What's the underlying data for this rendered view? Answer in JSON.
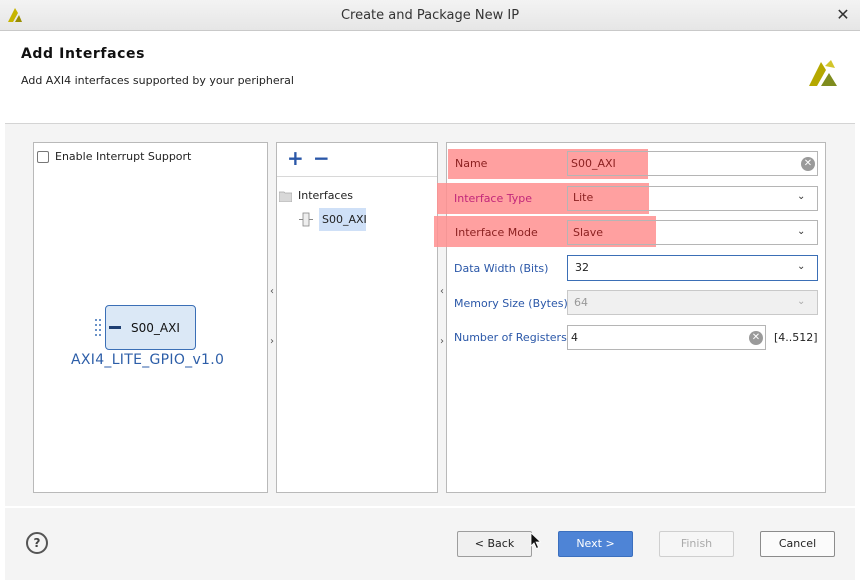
{
  "window": {
    "title": "Create and Package New IP",
    "close_glyph": "✕"
  },
  "header": {
    "title": "Add Interfaces",
    "subtitle": "Add AXI4 interfaces supported by your peripheral"
  },
  "left_panel": {
    "interrupt_label": "Enable Interrupt Support",
    "interrupt_checked": false,
    "ip_port": "S00_AXI",
    "ip_name": "AXI4_LITE_GPIO_v1.0"
  },
  "interfaces_panel": {
    "add_glyph": "+",
    "remove_glyph": "−",
    "root_label": "Interfaces",
    "items": [
      "S00_AXI"
    ]
  },
  "form": {
    "name": {
      "label": "Name",
      "value": "S00_AXI"
    },
    "interface_type": {
      "label": "Interface Type",
      "value": "Lite"
    },
    "interface_mode": {
      "label": "Interface Mode",
      "value": "Slave"
    },
    "data_width": {
      "label": "Data Width (Bits)",
      "value": "32"
    },
    "memory_size": {
      "label": "Memory Size (Bytes)",
      "value": "64"
    },
    "num_registers": {
      "label": "Number of Registers",
      "value": "4",
      "range": "[4..512]"
    }
  },
  "footer": {
    "help": "?",
    "back": "< Back",
    "next": "Next >",
    "finish": "Finish",
    "cancel": "Cancel"
  },
  "colors": {
    "accent": "#4e84d6",
    "highlight": "#ff8f8f",
    "label": "#2a57a8"
  }
}
